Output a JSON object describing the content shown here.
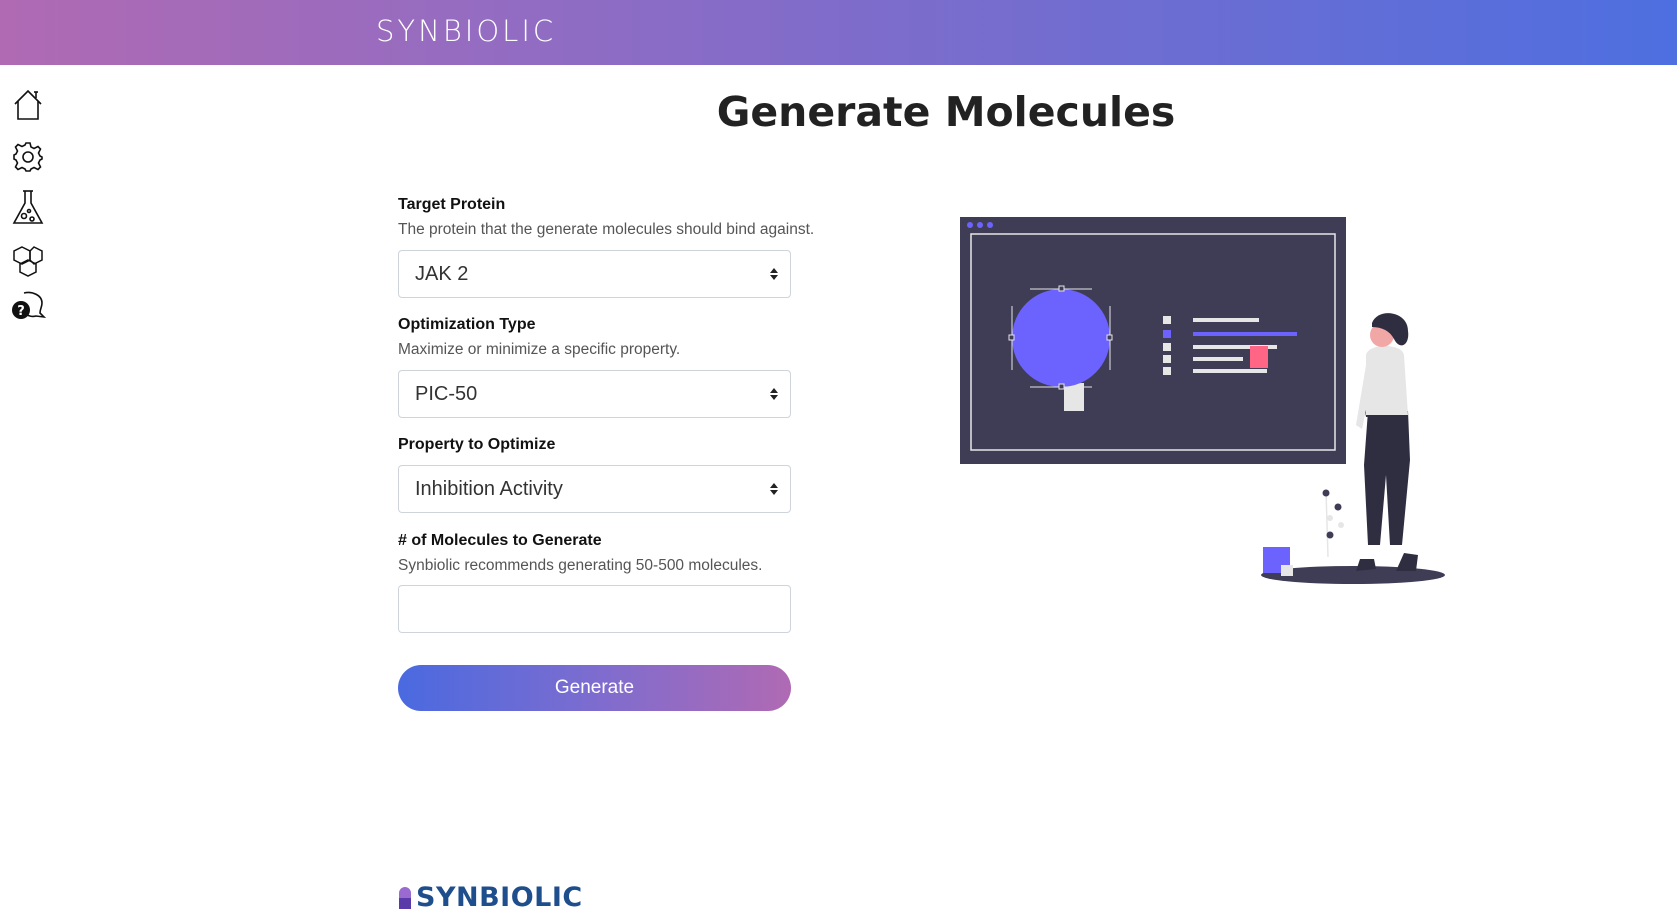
{
  "header": {
    "brand": "SYNBIOLIC",
    "gradient_start": "#b06ab3",
    "gradient_end": "#4e6fe0"
  },
  "sidebar": {
    "items": [
      {
        "icon": "home-icon"
      },
      {
        "icon": "gear-icon"
      },
      {
        "icon": "flask-icon"
      },
      {
        "icon": "molecule-icon"
      },
      {
        "icon": "help-icon"
      }
    ]
  },
  "page": {
    "title": "Generate Molecules"
  },
  "form": {
    "target_protein": {
      "label": "Target Protein",
      "help": "The protein that the generate molecules should bind against.",
      "value": "JAK 2"
    },
    "optimization_type": {
      "label": "Optimization Type",
      "help": "Maximize or minimize a specific property.",
      "value": "PIC-50"
    },
    "property": {
      "label": "Property to Optimize",
      "value": "Inhibition Activity"
    },
    "num_molecules": {
      "label": "# of Molecules to Generate",
      "help": "Synbiolic recommends generating 50-500 molecules.",
      "value": ""
    },
    "submit_label": "Generate"
  },
  "footer": {
    "logo_text": "SYNBIOLIC",
    "logo_color": "#1f4e8c"
  },
  "colors": {
    "accent": "#6c63ff",
    "dark_panel": "#3f3d56",
    "pink": "#ff6584"
  }
}
